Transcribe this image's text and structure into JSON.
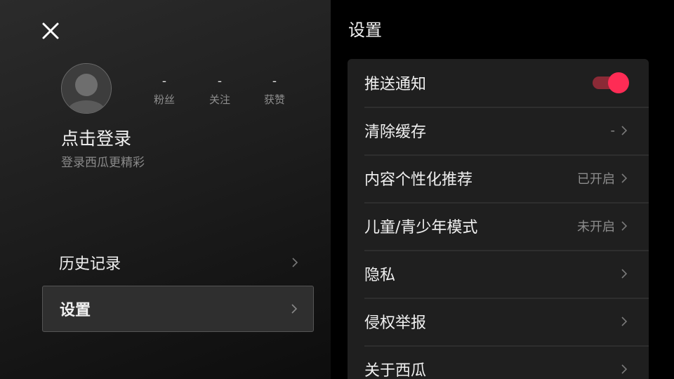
{
  "drawer": {
    "close_icon": "close-icon",
    "avatar_icon": "default-avatar-icon",
    "stats": [
      {
        "value": "-",
        "label": "粉丝"
      },
      {
        "value": "-",
        "label": "关注"
      },
      {
        "value": "-",
        "label": "获赞"
      }
    ],
    "login_title": "点击登录",
    "login_subtitle": "登录西瓜更精彩",
    "nav": [
      {
        "label": "历史记录",
        "selected": false
      },
      {
        "label": "设置",
        "selected": true
      }
    ]
  },
  "settings": {
    "title": "设置",
    "rows": [
      {
        "label": "推送通知",
        "toggle_on": true
      },
      {
        "label": "清除缓存",
        "value": "-"
      },
      {
        "label": "内容个性化推荐",
        "value": "已开启"
      },
      {
        "label": "儿童/青少年模式",
        "value": "未开启"
      },
      {
        "label": "隐私",
        "value": ""
      },
      {
        "label": "侵权举报",
        "value": ""
      },
      {
        "label": "关于西瓜",
        "value": ""
      }
    ]
  },
  "colors": {
    "accent": "#fe2c55",
    "toggle_track": "#8b2a36",
    "card_bg": "#1f1f1f",
    "secondary_text": "#8c8c8c"
  }
}
